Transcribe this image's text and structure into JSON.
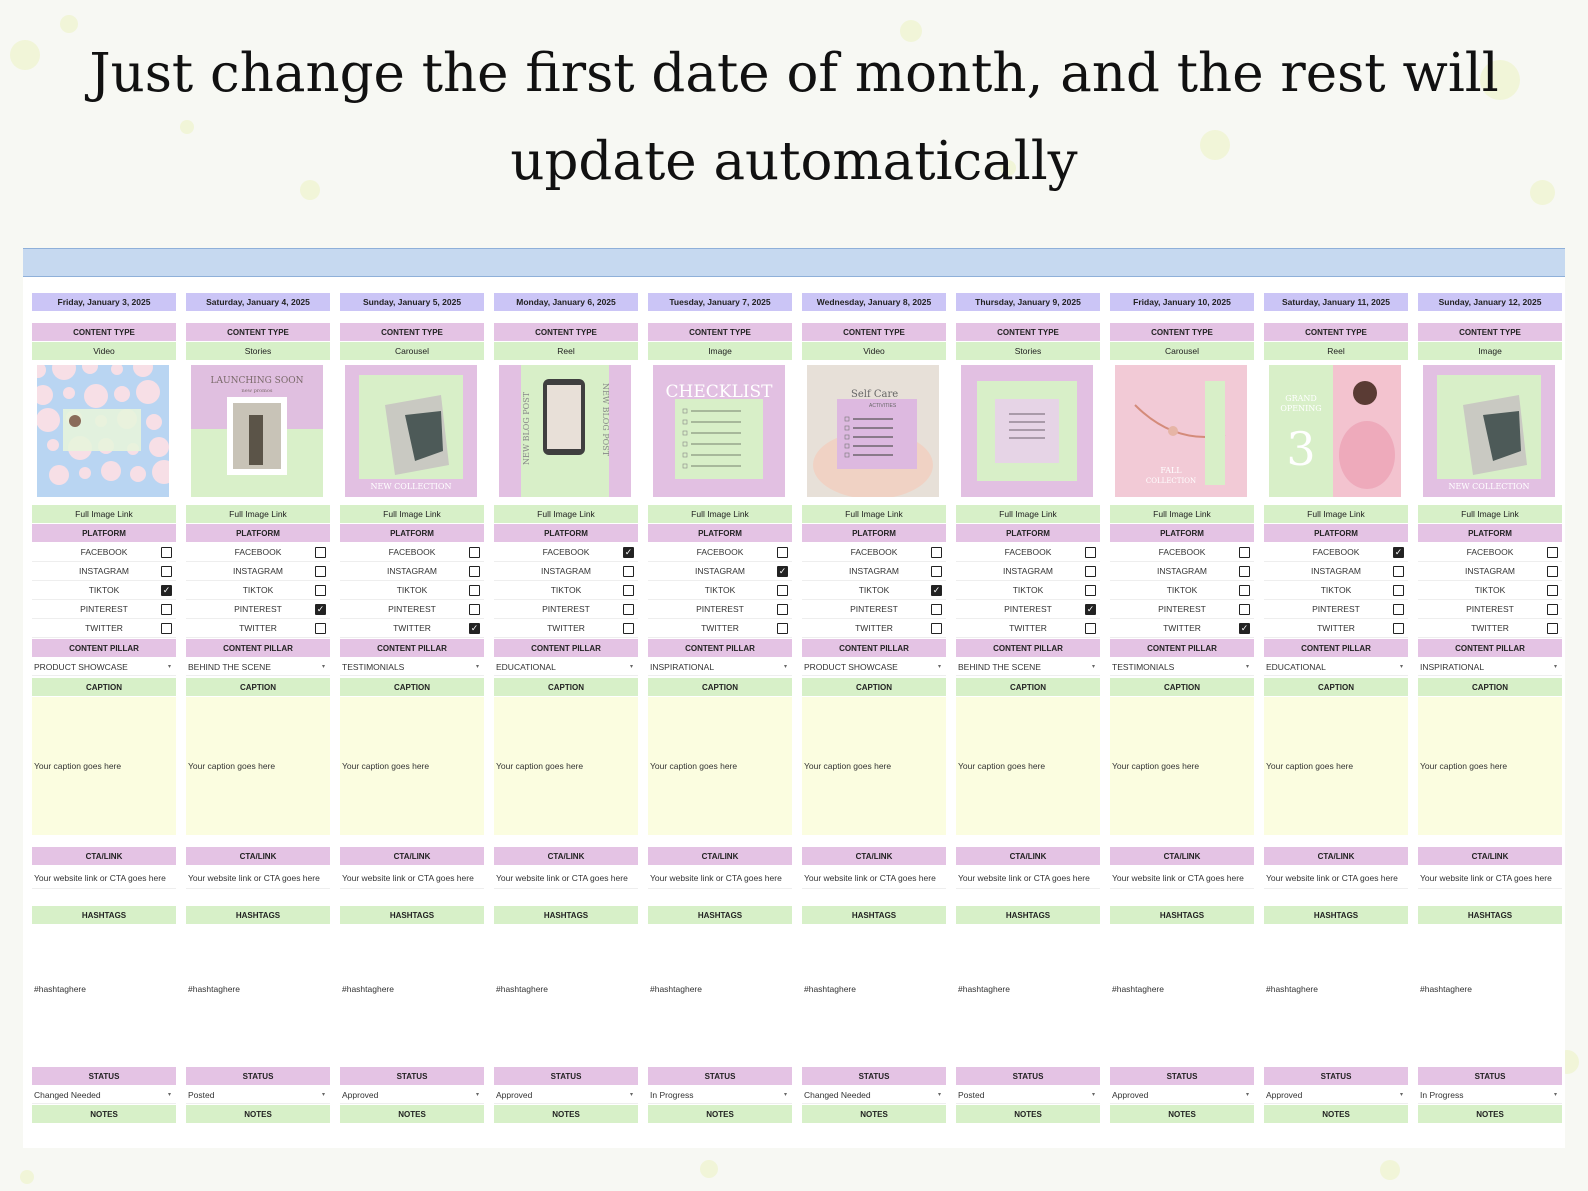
{
  "headline": [
    "Just change the first date of month, and the rest will",
    "update automatically"
  ],
  "labels": {
    "content_type": "CONTENT TYPE",
    "full_image_link": "Full Image Link",
    "platform": "PLATFORM",
    "content_pillar": "CONTENT PILLAR",
    "caption": "CAPTION",
    "caption_placeholder": "Your caption goes here",
    "cta_link": "CTA/LINK",
    "cta_placeholder": "Your website link or CTA goes here",
    "hashtags": "HASHTAGS",
    "hashtag_placeholder": "#hashtaghere",
    "status": "STATUS",
    "notes": "NOTES"
  },
  "platforms": [
    "FACEBOOK",
    "INSTAGRAM",
    "TIKTOK",
    "PINTEREST",
    "TWITTER"
  ],
  "days": [
    {
      "date": "Friday, January 3, 2025",
      "type": "Video",
      "checks": [
        false,
        false,
        true,
        false,
        false
      ],
      "pillar": "PRODUCT SHOWCASE",
      "status": "Changed Needed",
      "art": "cherry",
      "art_text": []
    },
    {
      "date": "Saturday, January 4, 2025",
      "type": "Stories",
      "checks": [
        false,
        false,
        false,
        true,
        false
      ],
      "pillar": "BEHIND THE SCENE",
      "status": "Posted",
      "art": "launch",
      "art_text": [
        "LAUNCHING SOON",
        "new promos"
      ]
    },
    {
      "date": "Sunday, January 5, 2025",
      "type": "Carousel",
      "checks": [
        false,
        false,
        false,
        false,
        true
      ],
      "pillar": "TESTIMONIALS",
      "status": "Approved",
      "art": "collection",
      "art_text": [
        "NEW COLLECTION"
      ]
    },
    {
      "date": "Monday, January 6, 2025",
      "type": "Reel",
      "checks": [
        true,
        false,
        false,
        false,
        false
      ],
      "pillar": "EDUCATIONAL",
      "status": "Approved",
      "art": "blog",
      "art_text": [
        "NEW BLOG POST"
      ]
    },
    {
      "date": "Tuesday, January 7, 2025",
      "type": "Image",
      "checks": [
        false,
        true,
        false,
        false,
        false
      ],
      "pillar": "INSPIRATIONAL",
      "status": "In Progress",
      "art": "checklist",
      "art_text": [
        "CHECKLIST"
      ]
    },
    {
      "date": "Wednesday, January 8, 2025",
      "type": "Video",
      "checks": [
        false,
        false,
        true,
        false,
        false
      ],
      "pillar": "PRODUCT SHOWCASE",
      "status": "Changed Needed",
      "art": "selfcare",
      "art_text": [
        "Self Care",
        "ACTIVITIES"
      ]
    },
    {
      "date": "Thursday, January 9, 2025",
      "type": "Stories",
      "checks": [
        false,
        false,
        false,
        true,
        false
      ],
      "pillar": "BEHIND THE SCENE",
      "status": "Posted",
      "art": "quote",
      "art_text": []
    },
    {
      "date": "Friday, January 10, 2025",
      "type": "Carousel",
      "checks": [
        false,
        false,
        false,
        false,
        true
      ],
      "pillar": "TESTIMONIALS",
      "status": "Approved",
      "art": "bracelet",
      "art_text": [
        "FALL",
        "COLLECTION"
      ]
    },
    {
      "date": "Saturday, January 11, 2025",
      "type": "Reel",
      "checks": [
        true,
        false,
        false,
        false,
        false
      ],
      "pillar": "EDUCATIONAL",
      "status": "Approved",
      "art": "opening",
      "art_text": [
        "GRAND",
        "OPENING",
        "3"
      ]
    },
    {
      "date": "Sunday, January 12, 2025",
      "type": "Image",
      "checks": [
        false,
        false,
        false,
        false,
        false
      ],
      "pillar": "INSPIRATIONAL",
      "status": "In Progress",
      "art": "collection",
      "art_text": [
        "NEW COLLECTION"
      ]
    }
  ],
  "colors": {
    "date_header": "#cbc5f6",
    "pink": "#e4c3e4",
    "green": "#d7f0c8",
    "caption_bg": "#fbfde0",
    "top_bar": "#c6d9f0"
  }
}
